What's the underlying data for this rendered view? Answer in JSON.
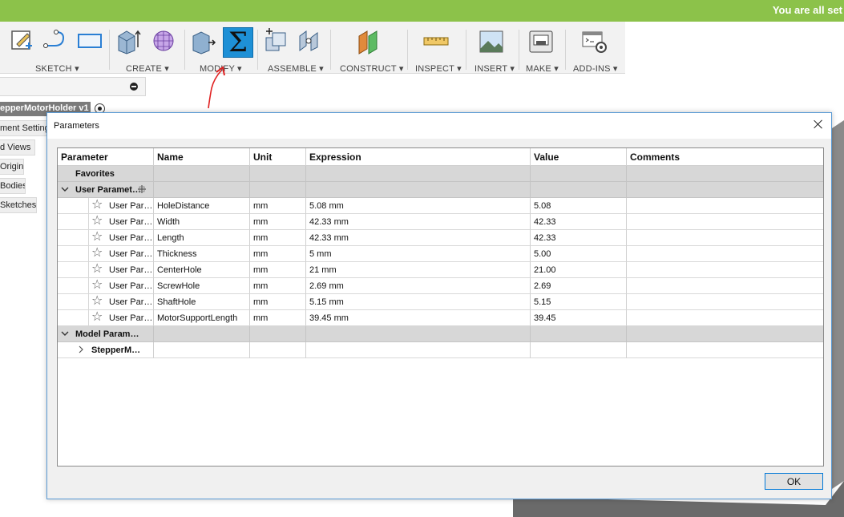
{
  "banner": {
    "text": "You are all set"
  },
  "toolbar": {
    "groups": [
      {
        "label": "SKETCH ▾"
      },
      {
        "label": "CREATE ▾"
      },
      {
        "label": "MODIFY ▾"
      },
      {
        "label": "ASSEMBLE ▾"
      },
      {
        "label": "CONSTRUCT ▾"
      },
      {
        "label": "INSPECT ▾"
      },
      {
        "label": "INSERT ▾"
      },
      {
        "label": "MAKE ▾"
      },
      {
        "label": "ADD-INS ▾"
      }
    ],
    "sigma_glyph": "Σ"
  },
  "browser": {
    "document_name": "epperMotorHolder v1",
    "items": [
      "ment Settings",
      "d Views",
      "Origin",
      "Bodies",
      "Sketches"
    ]
  },
  "dialog": {
    "title": "Parameters",
    "columns": [
      "Parameter",
      "Name",
      "Unit",
      "Expression",
      "Value",
      "Comments"
    ],
    "groups": {
      "favorites": "Favorites",
      "user": "User Paramet…",
      "model": "Model Param…",
      "model_child": "StepperM…"
    },
    "rows": [
      {
        "type": "User Par…",
        "name": "HoleDistance",
        "unit": "mm",
        "expression": "5.08 mm",
        "value": "5.08",
        "comments": ""
      },
      {
        "type": "User Par…",
        "name": "Width",
        "unit": "mm",
        "expression": "42.33 mm",
        "value": "42.33",
        "comments": ""
      },
      {
        "type": "User Par…",
        "name": "Length",
        "unit": "mm",
        "expression": "42.33 mm",
        "value": "42.33",
        "comments": ""
      },
      {
        "type": "User Par…",
        "name": "Thickness",
        "unit": "mm",
        "expression": "5 mm",
        "value": "5.00",
        "comments": ""
      },
      {
        "type": "User Par…",
        "name": "CenterHole",
        "unit": "mm",
        "expression": "21 mm",
        "value": "21.00",
        "comments": ""
      },
      {
        "type": "User Par…",
        "name": "ScrewHole",
        "unit": "mm",
        "expression": "2.69 mm",
        "value": "2.69",
        "comments": ""
      },
      {
        "type": "User Par…",
        "name": "ShaftHole",
        "unit": "mm",
        "expression": "5.15 mm",
        "value": "5.15",
        "comments": ""
      },
      {
        "type": "User Par…",
        "name": "MotorSupportLength",
        "unit": "mm",
        "expression": "39.45 mm",
        "value": "39.45",
        "comments": ""
      }
    ],
    "ok_label": "OK"
  },
  "colors": {
    "banner": "#8cc24a",
    "accent_sigma": "#1e90d6",
    "annotation": "#e02020",
    "dialog_border": "#5b9bd5"
  }
}
